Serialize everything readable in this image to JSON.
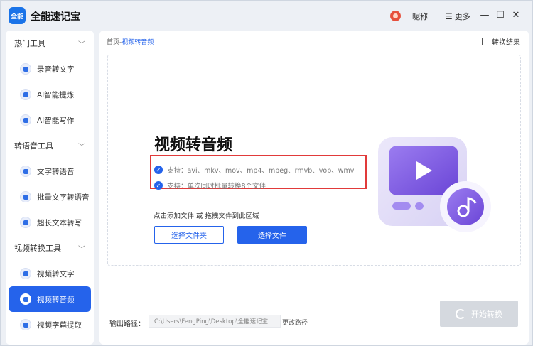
{
  "app": {
    "logo_text": "全能",
    "title": "全能速记宝",
    "nickname": "昵称",
    "more": "更多",
    "more_icon": "☰",
    "minimize": "—",
    "maximize": "☐",
    "close": "✕"
  },
  "sidebar": {
    "groups": [
      {
        "label": "热门工具",
        "items": [
          "录音转文字",
          "AI智能提炼",
          "AI智能写作"
        ]
      },
      {
        "label": "转语音工具",
        "items": [
          "文字转语音",
          "批量文字转语音",
          "超长文本转写"
        ]
      },
      {
        "label": "视频转换工具",
        "items": [
          "视频转文字",
          "视频转音频",
          "视频字幕提取"
        ]
      }
    ],
    "active_item": "视频转音频"
  },
  "breadcrumb": {
    "home": "首页",
    "sep": "-",
    "current": "视频转音频"
  },
  "result_button": "转换结果",
  "hero": {
    "title": "视频转音频",
    "support_formats": "支持：avi、mkv、mov、mp4、mpeg、rmvb、vob、wmv",
    "support_batch": "支持：单次同时批量转换8个文件",
    "hint": "点击添加文件 或 拖拽文件到此区域",
    "select_folder": "选择文件夹",
    "select_file": "选择文件"
  },
  "output": {
    "label": "输出路径：",
    "path": "C:\\Users\\FengPing\\Desktop\\全能速记宝",
    "change": "更改路径"
  },
  "start_button": "开始转换",
  "colors": {
    "accent": "#2563eb",
    "highlight": "#e13a3a",
    "disabled": "#d5d9df"
  }
}
